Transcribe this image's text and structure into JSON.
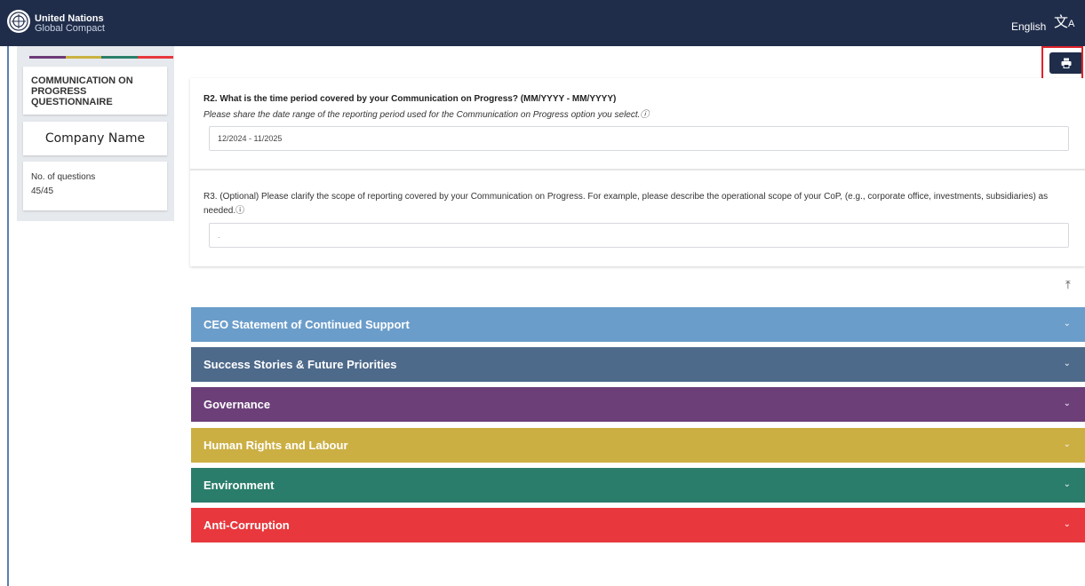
{
  "header": {
    "brand_line1": "United Nations",
    "brand_line2": "Global Compact",
    "language": "English",
    "translate_icon": "translate-icon",
    "background": "#1f2d4a"
  },
  "sidebar": {
    "stripe_colors": [
      "#6d3b7a",
      "#c9b240",
      "#2a7f6b",
      "#e8383d"
    ],
    "title": "COMMUNICATION ON PROGRESS QUESTIONNAIRE",
    "company": "Company Name",
    "questions_label": "No. of questions",
    "questions_value": "45/45"
  },
  "questions": [
    {
      "title": "R2. What is the time period covered by your Communication on Progress? (MM/YYYY - MM/YYYY)",
      "help": "Please share the date range of the reporting period used for the Communication on Progress option you select.",
      "value": "12/2024 - 11/2025"
    },
    {
      "title": "R3. (Optional) Please clarify the scope of reporting covered by your Communication on Progress. For example, please describe the operational scope of your CoP, (e.g., corporate office, investments, subsidiaries) as needed.",
      "value": "."
    }
  ],
  "info_icon": "ⓘ",
  "back_to_top_icon": "⤒",
  "chevron": "⌄",
  "sections": [
    {
      "label": "CEO Statement of Continued Support",
      "color": "#6b9dca"
    },
    {
      "label": "Success Stories & Future Priorities",
      "color": "#4e6a8b"
    },
    {
      "label": "Governance",
      "color": "#6d3f79"
    },
    {
      "label": "Human Rights and Labour",
      "color": "#cbaf43"
    },
    {
      "label": "Environment",
      "color": "#2a7d6b"
    },
    {
      "label": "Anti-Corruption",
      "color": "#e8383d"
    }
  ]
}
